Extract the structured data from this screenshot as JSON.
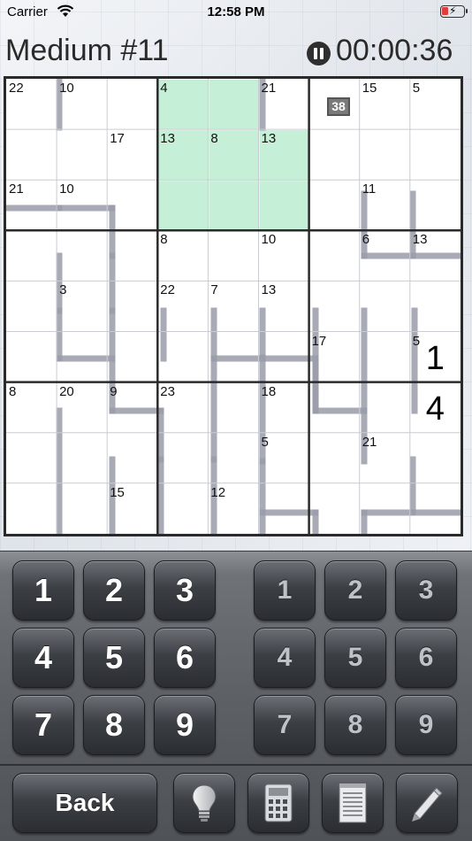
{
  "status_bar": {
    "carrier": "Carrier",
    "time": "12:58 PM"
  },
  "header": {
    "title": "Medium #11",
    "timer": "00:00:36"
  },
  "board": {
    "highlight_color": "#c6efd8",
    "cage_color": "#9a9daa",
    "badge": "38",
    "cage_sums": [
      {
        "r": 0,
        "c": 0,
        "s": "22"
      },
      {
        "r": 0,
        "c": 1,
        "s": "10"
      },
      {
        "r": 0,
        "c": 3,
        "s": "4"
      },
      {
        "r": 0,
        "c": 5,
        "s": "21"
      },
      {
        "r": 0,
        "c": 7,
        "s": "15"
      },
      {
        "r": 0,
        "c": 8,
        "s": "5"
      },
      {
        "r": 1,
        "c": 2,
        "s": "17"
      },
      {
        "r": 1,
        "c": 3,
        "s": "13"
      },
      {
        "r": 1,
        "c": 4,
        "s": "8"
      },
      {
        "r": 1,
        "c": 5,
        "s": "13"
      },
      {
        "r": 2,
        "c": 0,
        "s": "21"
      },
      {
        "r": 2,
        "c": 1,
        "s": "10"
      },
      {
        "r": 2,
        "c": 7,
        "s": "11"
      },
      {
        "r": 3,
        "c": 3,
        "s": "8"
      },
      {
        "r": 3,
        "c": 5,
        "s": "10"
      },
      {
        "r": 3,
        "c": 7,
        "s": "6"
      },
      {
        "r": 3,
        "c": 8,
        "s": "13"
      },
      {
        "r": 4,
        "c": 1,
        "s": "3"
      },
      {
        "r": 4,
        "c": 3,
        "s": "22"
      },
      {
        "r": 4,
        "c": 4,
        "s": "7"
      },
      {
        "r": 4,
        "c": 5,
        "s": "13"
      },
      {
        "r": 5,
        "c": 6,
        "s": "17"
      },
      {
        "r": 5,
        "c": 8,
        "s": "5"
      },
      {
        "r": 6,
        "c": 0,
        "s": "8"
      },
      {
        "r": 6,
        "c": 1,
        "s": "20"
      },
      {
        "r": 6,
        "c": 2,
        "s": "9"
      },
      {
        "r": 6,
        "c": 3,
        "s": "23"
      },
      {
        "r": 6,
        "c": 5,
        "s": "18"
      },
      {
        "r": 7,
        "c": 5,
        "s": "5"
      },
      {
        "r": 7,
        "c": 7,
        "s": "21"
      },
      {
        "r": 8,
        "c": 2,
        "s": "15"
      },
      {
        "r": 8,
        "c": 4,
        "s": "12"
      }
    ],
    "cell_values": [
      {
        "r": 5,
        "c": 8,
        "v": "1"
      },
      {
        "r": 6,
        "c": 8,
        "v": "4"
      }
    ]
  },
  "keypad": {
    "digits": [
      "1",
      "2",
      "3",
      "4",
      "5",
      "6",
      "7",
      "8",
      "9"
    ],
    "note_digits": [
      "1",
      "2",
      "3",
      "4",
      "5",
      "6",
      "7",
      "8",
      "9"
    ],
    "back_label": "Back",
    "tools": [
      "lightbulb-icon",
      "calculator-icon",
      "notepad-icon",
      "pencil-icon"
    ]
  }
}
